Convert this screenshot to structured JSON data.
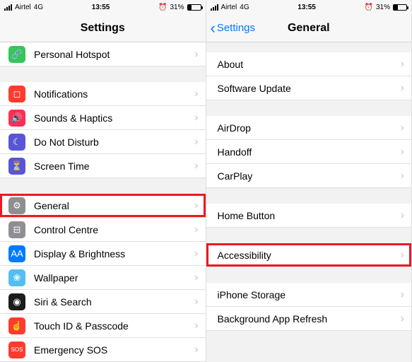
{
  "status": {
    "carrier": "Airtel",
    "network": "4G",
    "time": "13:55",
    "battery_pct": "31%",
    "alarm_icon": "⏰"
  },
  "left": {
    "title": "Settings",
    "groups": [
      [
        {
          "label": "Personal Hotspot",
          "icon_bg": "#34c759",
          "icon_name": "hotspot-icon",
          "glyph": "🔗"
        }
      ],
      [
        {
          "label": "Notifications",
          "icon_bg": "#ff3b30",
          "icon_name": "notifications-icon",
          "glyph": "◻"
        },
        {
          "label": "Sounds & Haptics",
          "icon_bg": "#ff2d55",
          "icon_name": "sounds-icon",
          "glyph": "🔊"
        },
        {
          "label": "Do Not Disturb",
          "icon_bg": "#5856d6",
          "icon_name": "dnd-icon",
          "glyph": "☾"
        },
        {
          "label": "Screen Time",
          "icon_bg": "#5856d6",
          "icon_name": "screentime-icon",
          "glyph": "⏳"
        }
      ],
      [
        {
          "label": "General",
          "icon_bg": "#8e8e93",
          "icon_name": "general-icon",
          "glyph": "⚙",
          "highlight": true
        },
        {
          "label": "Control Centre",
          "icon_bg": "#8e8e93",
          "icon_name": "control-centre-icon",
          "glyph": "⊟"
        },
        {
          "label": "Display & Brightness",
          "icon_bg": "#007aff",
          "icon_name": "display-icon",
          "glyph": "AA"
        },
        {
          "label": "Wallpaper",
          "icon_bg": "#55bef0",
          "icon_name": "wallpaper-icon",
          "glyph": "❀"
        },
        {
          "label": "Siri & Search",
          "icon_bg": "#1c1c1e",
          "icon_name": "siri-icon",
          "glyph": "◉"
        },
        {
          "label": "Touch ID & Passcode",
          "icon_bg": "#ff3b30",
          "icon_name": "touchid-icon",
          "glyph": "☝"
        },
        {
          "label": "Emergency SOS",
          "icon_bg": "#ff3b30",
          "icon_name": "sos-icon",
          "glyph": "SOS",
          "glyph_small": true
        }
      ]
    ]
  },
  "right": {
    "back_label": "Settings",
    "title": "General",
    "groups": [
      [
        {
          "label": "About"
        },
        {
          "label": "Software Update"
        }
      ],
      [
        {
          "label": "AirDrop"
        },
        {
          "label": "Handoff"
        },
        {
          "label": "CarPlay"
        }
      ],
      [
        {
          "label": "Home Button"
        }
      ],
      [
        {
          "label": "Accessibility",
          "highlight": true
        }
      ],
      [
        {
          "label": "iPhone Storage"
        },
        {
          "label": "Background App Refresh"
        }
      ]
    ]
  }
}
